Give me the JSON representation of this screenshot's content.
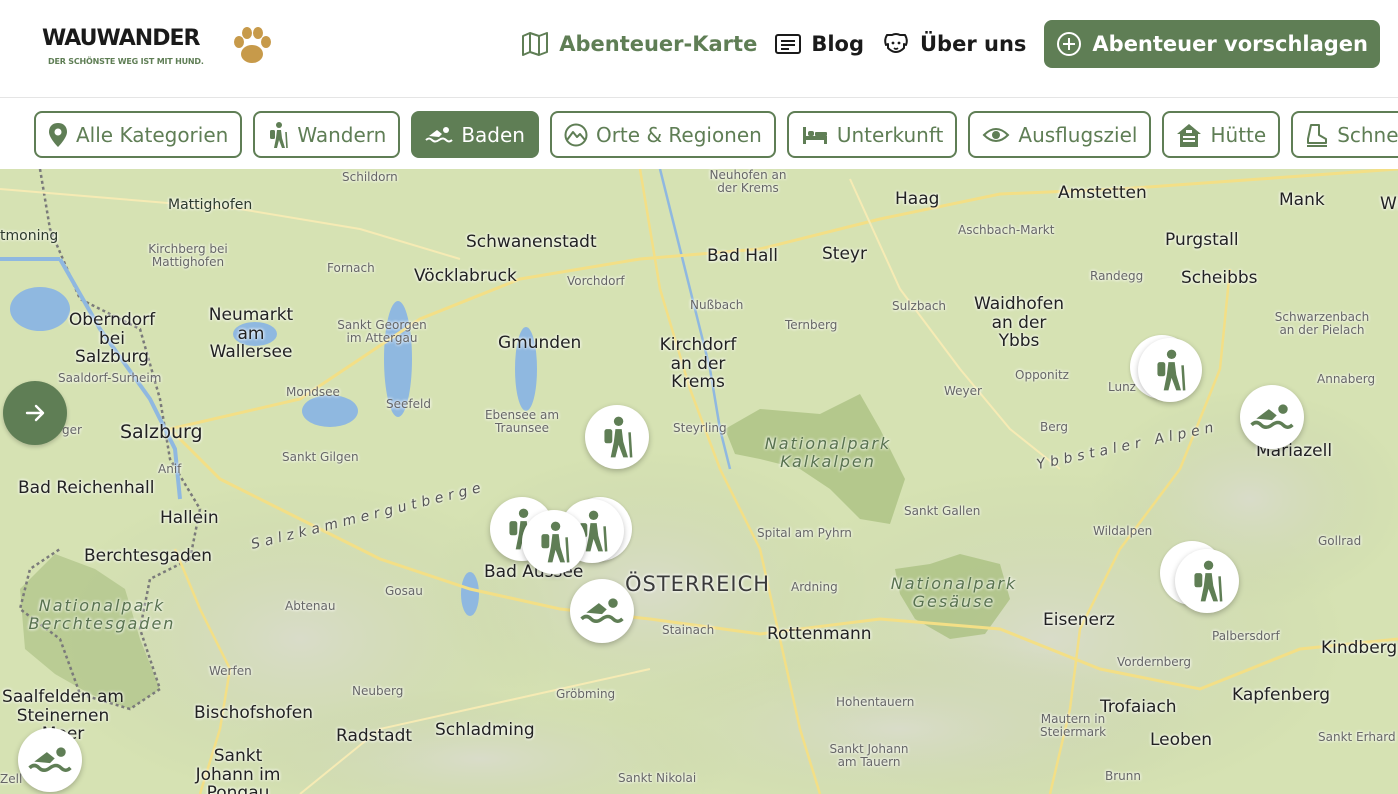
{
  "brand": {
    "name": "WAUWANDER",
    "tagline": "DER SCHÖNSTE WEG IST MIT HUND.",
    "accent": "#5f7e55"
  },
  "nav": {
    "items": [
      {
        "label": "Abenteuer-Karte",
        "icon": "map-icon",
        "active": true
      },
      {
        "label": "Blog",
        "icon": "newspaper-icon",
        "active": false
      },
      {
        "label": "Über uns",
        "icon": "dog-icon",
        "active": false
      }
    ],
    "cta": {
      "label": "Abenteuer vorschlagen",
      "icon": "plus-circle-icon"
    }
  },
  "categories": [
    {
      "label": "Alle Kategorien",
      "icon": "location-pin-icon",
      "active": false
    },
    {
      "label": "Wandern",
      "icon": "hiker-icon",
      "active": false
    },
    {
      "label": "Baden",
      "icon": "swimmer-icon",
      "active": true
    },
    {
      "label": "Orte & Regionen",
      "icon": "mountain-circle-icon",
      "active": false
    },
    {
      "label": "Unterkunft",
      "icon": "bed-icon",
      "active": false
    },
    {
      "label": "Ausflugsziel",
      "icon": "eye-icon",
      "active": false
    },
    {
      "label": "Hütte",
      "icon": "hut-icon",
      "active": false
    },
    {
      "label": "Schnees",
      "icon": "snow-boot-icon",
      "active": false
    }
  ],
  "map": {
    "labels": {
      "mattighofen": "Mattighofen",
      "tmoning": "tmoning",
      "kirchberg": "Kirchberg bei Mattighofen",
      "fornach": "Fornach",
      "schildorn": "Schildorn",
      "schwanenstadt": "Schwanenstadt",
      "voecklabruck": "Vöcklabruck",
      "vorchdorf": "Vorchdorf",
      "badhall": "Bad Hall",
      "steyr": "Steyr",
      "neuhofen": "Neuhofen an der Krems",
      "haag": "Haag",
      "amstetten": "Amstetten",
      "aschbach": "Aschbach-Markt",
      "mank": "Mank",
      "wi": "Wi",
      "purgstall": "Purgstall",
      "randegg": "Randegg",
      "scheibbs": "Scheibbs",
      "oberndorf": "Oberndorf bei Salzburg",
      "neumarkt": "Neumarkt am Wallersee",
      "sanktgeorgen": "Sankt Georgen im Attergau",
      "gmunden": "Gmunden",
      "nussbach": "Nußbach",
      "kirchdorf": "Kirchdorf an der Krems",
      "ternberg": "Ternberg",
      "sulzbach": "Sulzbach",
      "waidhofen": "Waidhofen an der Ybbs",
      "schwarzenbach": "Schwarzenbach an der Pielach",
      "saaldorf": "Saaldorf-Surheim",
      "mondsee": "Mondsee",
      "seefeld": "Seefeld",
      "ebensee": "Ebensee am Traunsee",
      "weyer": "Weyer",
      "opponitz": "Opponitz",
      "lunz": "Lunz",
      "annaberg": "Annaberg",
      "salzburg": "Salzburg",
      "ger": "ger",
      "sanktgilgen": "Sankt Gilgen",
      "steyrling": "Steyrling",
      "nationalparkkalkalpen": "Nationalpark Kalkalpen",
      "berg": "Berg",
      "ybbstaler": "Ybbstaler Alpen",
      "mariazell": "Mariazell",
      "badreichenhall": "Bad Reichenhall",
      "anif": "Anif",
      "hallein": "Hallein",
      "salzkammergut": "Salzkammergutberge",
      "sanktgallen": "Sankt Gallen",
      "wildalpen": "Wildalpen",
      "berchtesgaden": "Berchtesgaden",
      "spital": "Spital am Pyhrn",
      "gollrad": "Gollrad",
      "badaussee": "Bad Aussee",
      "gosau": "Gosau",
      "oesterreich": "ÖSTERREICH",
      "ardning": "Ardning",
      "nationalparkgesaeuse": "Nationalpark Gesäuse",
      "nationalparkberchtesgaden": "Nationalpark Berchtesgaden",
      "abtenau": "Abtenau",
      "stainach": "Stainach",
      "rottenmann": "Rottenmann",
      "eisenerz": "Eisenerz",
      "palbersdorf": "Palbersdorf",
      "kindberg": "Kindberg",
      "werfen": "Werfen",
      "vordernberg": "Vordernberg",
      "saalfelden": "Saalfelden am Steinernen Meer",
      "neuberg": "Neuberg",
      "groebming": "Gröbming",
      "hohentauern": "Hohentauern",
      "trofaiach": "Trofaiach",
      "kapfenberg": "Kapfenberg",
      "bischofshofen": "Bischofshofen",
      "mautern": "Mautern in Steiermark",
      "radstadt": "Radstadt",
      "schladming": "Schladming",
      "leoben": "Leoben",
      "sankterhard": "Sankt Erhard",
      "sanktjohannpongau": "Sankt Johann im Pongau",
      "sanktjohanntauern": "Sankt Johann am Tauern",
      "sanktnikolai": "Sankt Nikolai",
      "bruno": "Brunn",
      "zell": "Zell"
    }
  }
}
